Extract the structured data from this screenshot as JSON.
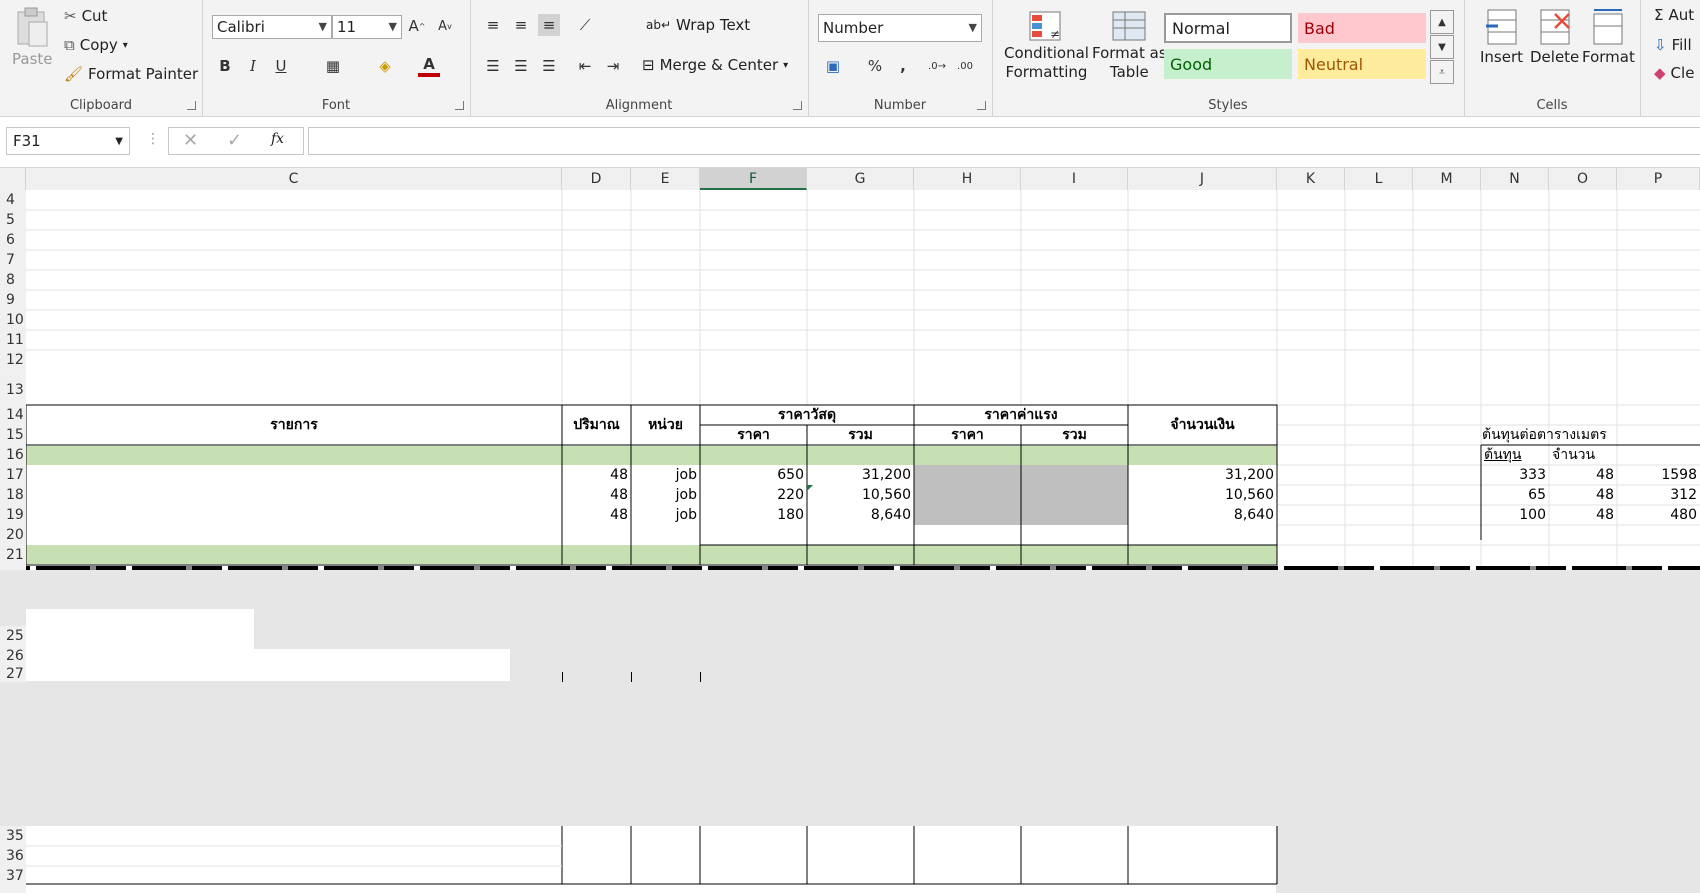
{
  "ribbon": {
    "clipboard": {
      "paste": "Paste",
      "cut": "Cut",
      "copy": "Copy",
      "format_painter": "Format Painter",
      "label": "Clipboard"
    },
    "font": {
      "name": "Calibri",
      "size": "11",
      "bold": "B",
      "italic": "I",
      "underline": "U",
      "label": "Font",
      "font_color": "#c00000"
    },
    "alignment": {
      "wrap_text": "Wrap Text",
      "merge_center": "Merge & Center",
      "label": "Alignment"
    },
    "number": {
      "format": "Number",
      "label": "Number",
      "percent": "%",
      "comma": ","
    },
    "styles": {
      "conditional": "Conditional",
      "formatting": "Formatting",
      "format_as": "Format as",
      "table": "Table",
      "normal": "Normal",
      "bad": "Bad",
      "good": "Good",
      "neutral": "Neutral",
      "label": "Styles"
    },
    "cells": {
      "insert": "Insert",
      "delete": "Delete",
      "format": "Format",
      "label": "Cells"
    },
    "editing": {
      "autosum": "Aut",
      "fill": "Fill",
      "clear": "Cle"
    }
  },
  "formula_bar": {
    "name_box": "F31",
    "fx": "fx",
    "value": ""
  },
  "columns": [
    "C",
    "D",
    "E",
    "F",
    "G",
    "H",
    "I",
    "J",
    "K",
    "L",
    "M",
    "N",
    "O",
    "P"
  ],
  "rows_top": [
    "4",
    "5",
    "6",
    "7",
    "8",
    "9",
    "10",
    "11",
    "12",
    "13",
    "14",
    "15",
    "16",
    "17",
    "18",
    "19",
    "20",
    "21"
  ],
  "rows_bottom": [
    "25",
    "26",
    "27",
    "35",
    "36",
    "37"
  ],
  "table": {
    "h_item": "รายการ",
    "h_qty": "ปริมาณ",
    "h_unit": "หน่วย",
    "h_material": "ราคาวัสดุ",
    "h_labor": "ราคาค่าแรง",
    "h_amount": "จำนวนเงิน",
    "h_price": "ราคา",
    "h_total": "รวม",
    "h_price2": "ราคา",
    "h_total2": "รวม",
    "rows": [
      {
        "qty": "48",
        "unit": "job",
        "price": "650",
        "total": "31,200",
        "amount": "31,200"
      },
      {
        "qty": "48",
        "unit": "job",
        "price": "220",
        "total": "10,560",
        "amount": "10,560"
      },
      {
        "qty": "48",
        "unit": "job",
        "price": "180",
        "total": "8,640",
        "amount": "8,640"
      }
    ]
  },
  "side_table": {
    "title": "ต้นทุนต่อตารางเมตร",
    "h_cost": "ต้นทุน",
    "h_qty": "จำนวน",
    "rows": [
      {
        "cost": "333",
        "qty": "48",
        "p": "1598"
      },
      {
        "cost": "65",
        "qty": "48",
        "p": "312"
      },
      {
        "cost": "100",
        "qty": "48",
        "p": "480"
      }
    ]
  }
}
